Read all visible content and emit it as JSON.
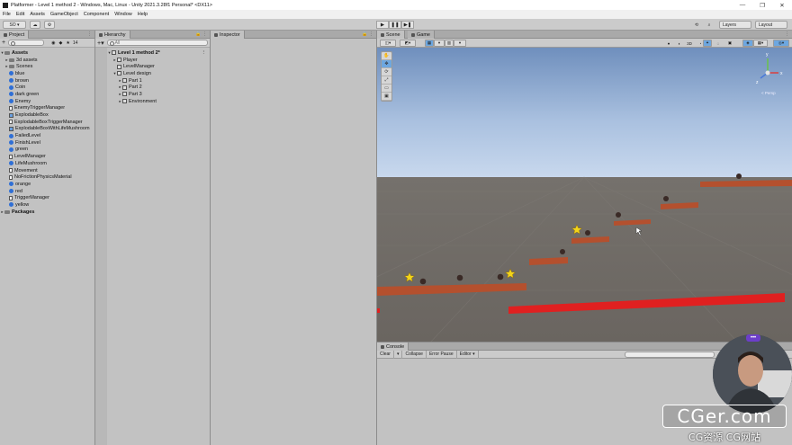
{
  "window": {
    "title": "Platformer - Level 1 method 2 - Windows, Mac, Linux - Unity 2021.3.28f1 Personal* <DX11>",
    "controls": [
      "—",
      "❐",
      "✕"
    ]
  },
  "menu": [
    "File",
    "Edit",
    "Assets",
    "GameObject",
    "Component",
    "Window",
    "Help"
  ],
  "toolbar": {
    "account": "SO ▾",
    "layers": "Layers",
    "layout": "Layout"
  },
  "project": {
    "tab": "Project",
    "count": "14",
    "search_placeholder": "",
    "root": "Assets",
    "items": [
      {
        "label": "3d assets",
        "kind": "folder",
        "caret": "▸"
      },
      {
        "label": "Scenes",
        "kind": "folder",
        "caret": "▸"
      },
      {
        "label": "blue",
        "kind": "material",
        "color": "#2f6fd6"
      },
      {
        "label": "brown",
        "kind": "material",
        "color": "#2f6fd6"
      },
      {
        "label": "Coin",
        "kind": "material",
        "color": "#2f6fd6"
      },
      {
        "label": "dark green",
        "kind": "material",
        "color": "#2f6fd6"
      },
      {
        "label": "Enemy",
        "kind": "material",
        "color": "#2f6fd6"
      },
      {
        "label": "EnemyTriggerManager",
        "kind": "script"
      },
      {
        "label": "ExplodableBox",
        "kind": "prefab"
      },
      {
        "label": "ExplodableBoxTriggerManager",
        "kind": "script"
      },
      {
        "label": "ExplodableBoxWithLifeMushroom",
        "kind": "prefab"
      },
      {
        "label": "FailedLevel",
        "kind": "material",
        "color": "#2f6fd6"
      },
      {
        "label": "FinishLevel",
        "kind": "material",
        "color": "#2f6fd6"
      },
      {
        "label": "green",
        "kind": "material",
        "color": "#2f6fd6"
      },
      {
        "label": "LevelManager",
        "kind": "script"
      },
      {
        "label": "LifeMushroom",
        "kind": "material",
        "color": "#2f6fd6"
      },
      {
        "label": "Movement",
        "kind": "script"
      },
      {
        "label": "NoFrictionPhysicsMaterial",
        "kind": "script"
      },
      {
        "label": "orange",
        "kind": "material",
        "color": "#2f6fd6"
      },
      {
        "label": "red",
        "kind": "material",
        "color": "#2f6fd6"
      },
      {
        "label": "TriggerManager",
        "kind": "script"
      },
      {
        "label": "yellow",
        "kind": "material",
        "color": "#2f6fd6"
      }
    ],
    "packages": "Packages"
  },
  "hierarchy": {
    "tab": "Hierarchy",
    "search_placeholder": "All",
    "scene": "Level 1 method 2*",
    "items": [
      {
        "label": "Player",
        "depth": 1,
        "caret": "▸"
      },
      {
        "label": "LevelManager",
        "depth": 1,
        "caret": ""
      },
      {
        "label": "Level design",
        "depth": 1,
        "caret": "▾"
      },
      {
        "label": "Part 1",
        "depth": 2,
        "caret": "▸"
      },
      {
        "label": "Part 2",
        "depth": 2,
        "caret": "▸"
      },
      {
        "label": "Part 3",
        "depth": 2,
        "caret": "▸"
      },
      {
        "label": "Environment",
        "depth": 2,
        "caret": "▸"
      }
    ]
  },
  "inspector": {
    "tab": "Inspector"
  },
  "scene": {
    "tabs": [
      "Scene",
      "Game"
    ],
    "mode_2d": "3D",
    "gizmo_label": "< Persp",
    "gizmo_axes": [
      "y",
      "x",
      "z"
    ]
  },
  "console": {
    "tab": "Console",
    "buttons": [
      "Clear",
      "▾",
      "Collapse",
      "Error Pause",
      "Editor ▾"
    ]
  },
  "overlay": {
    "badge": "•••",
    "watermark": "CGer.com",
    "watermark_sub": "CG资源  CG网站"
  },
  "colors": {
    "platform": "#b4502e",
    "platform_red": "#e02020",
    "coin": "#f2d41a",
    "enemy": "#3a2a26",
    "selection": "#6da7e0"
  }
}
